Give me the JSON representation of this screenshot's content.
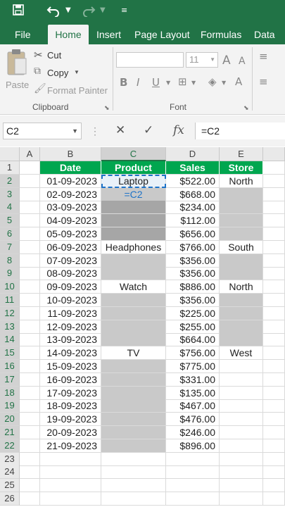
{
  "toolbar": {
    "save_icon": "save-icon",
    "undo_icon": "undo-icon",
    "redo_icon": "redo-icon",
    "customize_icon": "customize-qat-icon"
  },
  "tabs": [
    "File",
    "Home",
    "Insert",
    "Page Layout",
    "Formulas",
    "Data"
  ],
  "active_tab": "Home",
  "ribbon": {
    "paste_label": "Paste",
    "cut_label": "Cut",
    "copy_label": "Copy",
    "format_painter_label": "Format Painter",
    "clipboard_group": "Clipboard",
    "font_group": "Font",
    "font_size": "11",
    "grow_font": "A",
    "shrink_font": "A",
    "bold": "B",
    "italic": "I",
    "underline": "U",
    "font_color": "A"
  },
  "formula_bar": {
    "name_box": "C2",
    "cancel_icon": "cancel-icon",
    "enter_icon": "check-icon",
    "fx_label": "fx",
    "formula": "=C2"
  },
  "columns": [
    "A",
    "B",
    "C",
    "D",
    "E"
  ],
  "rows": [
    "1",
    "2",
    "3",
    "4",
    "5",
    "6",
    "7",
    "8",
    "9",
    "10",
    "11",
    "12",
    "13",
    "14",
    "15",
    "16",
    "17",
    "18",
    "19",
    "20",
    "21",
    "22",
    "23",
    "24",
    "25",
    "26"
  ],
  "headers": {
    "date": "Date",
    "product": "Product",
    "sales": "Sales",
    "store": "Store"
  },
  "data": [
    {
      "date": "01-09-2023",
      "product": "Laptop",
      "sales": "$522.00",
      "store": "North"
    },
    {
      "date": "02-09-2023",
      "product": "=C2",
      "sales": "$668.00",
      "store": ""
    },
    {
      "date": "03-09-2023",
      "product": "",
      "sales": "$234.00",
      "store": ""
    },
    {
      "date": "04-09-2023",
      "product": "",
      "sales": "$112.00",
      "store": ""
    },
    {
      "date": "05-09-2023",
      "product": "",
      "sales": "$656.00",
      "store": ""
    },
    {
      "date": "06-09-2023",
      "product": "Headphones",
      "sales": "$766.00",
      "store": "South"
    },
    {
      "date": "07-09-2023",
      "product": "",
      "sales": "$356.00",
      "store": ""
    },
    {
      "date": "08-09-2023",
      "product": "",
      "sales": "$356.00",
      "store": ""
    },
    {
      "date": "09-09-2023",
      "product": "Watch",
      "sales": "$886.00",
      "store": "North"
    },
    {
      "date": "10-09-2023",
      "product": "",
      "sales": "$356.00",
      "store": ""
    },
    {
      "date": "11-09-2023",
      "product": "",
      "sales": "$225.00",
      "store": ""
    },
    {
      "date": "12-09-2023",
      "product": "",
      "sales": "$255.00",
      "store": ""
    },
    {
      "date": "13-09-2023",
      "product": "",
      "sales": "$664.00",
      "store": ""
    },
    {
      "date": "14-09-2023",
      "product": "TV",
      "sales": "$756.00",
      "store": "West"
    },
    {
      "date": "15-09-2023",
      "product": "",
      "sales": "$775.00",
      "store": ""
    },
    {
      "date": "16-09-2023",
      "product": "",
      "sales": "$331.00",
      "store": ""
    },
    {
      "date": "17-09-2023",
      "product": "",
      "sales": "$135.00",
      "store": ""
    },
    {
      "date": "18-09-2023",
      "product": "",
      "sales": "$467.00",
      "store": ""
    },
    {
      "date": "19-09-2023",
      "product": "",
      "sales": "$476.00",
      "store": ""
    },
    {
      "date": "20-09-2023",
      "product": "",
      "sales": "$246.00",
      "store": ""
    },
    {
      "date": "21-09-2023",
      "product": "",
      "sales": "$896.00",
      "store": ""
    }
  ],
  "colors": {
    "ribbon_green": "#217346",
    "header_fill": "#00a64f",
    "blank_fill_selected": "#a6a6a6",
    "blank_fill": "#c9c9c9",
    "formula_ref": "#1e73c8"
  }
}
